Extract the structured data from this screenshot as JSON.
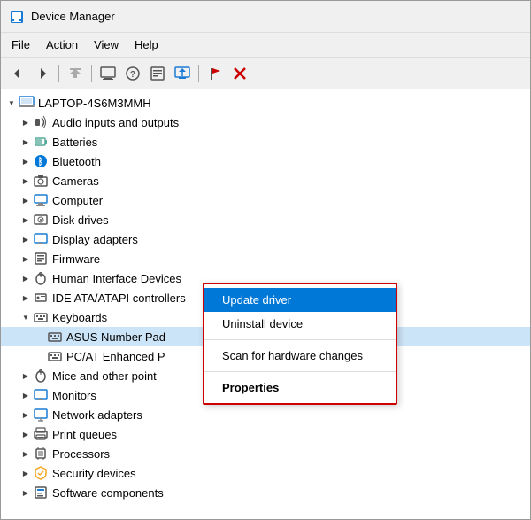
{
  "window": {
    "title": "Device Manager",
    "icon": "🖥"
  },
  "menu": {
    "items": [
      "File",
      "Action",
      "View",
      "Help"
    ]
  },
  "toolbar": {
    "buttons": [
      {
        "name": "back",
        "icon": "←",
        "disabled": false
      },
      {
        "name": "forward",
        "icon": "→",
        "disabled": false
      },
      {
        "name": "up",
        "icon": "↑",
        "disabled": true
      },
      {
        "name": "computer",
        "icon": "💻",
        "disabled": false
      },
      {
        "name": "help",
        "icon": "?",
        "disabled": false
      },
      {
        "name": "properties",
        "icon": "📋",
        "disabled": false
      },
      {
        "name": "monitor",
        "icon": "🖥",
        "disabled": false
      },
      {
        "name": "flag",
        "icon": "🚩",
        "disabled": false
      },
      {
        "name": "remove",
        "icon": "✖",
        "disabled": false,
        "red": true
      }
    ]
  },
  "tree": {
    "root": "LAPTOP-4S6M3MMH",
    "nodes": [
      {
        "label": "Audio inputs and outputs",
        "indent": 1,
        "expanded": false,
        "icon": "🔊"
      },
      {
        "label": "Batteries",
        "indent": 1,
        "expanded": false,
        "icon": "🔋"
      },
      {
        "label": "Bluetooth",
        "indent": 1,
        "expanded": false,
        "icon": "🔵"
      },
      {
        "label": "Cameras",
        "indent": 1,
        "expanded": false,
        "icon": "📷"
      },
      {
        "label": "Computer",
        "indent": 1,
        "expanded": false,
        "icon": "🖥"
      },
      {
        "label": "Disk drives",
        "indent": 1,
        "expanded": false,
        "icon": "💾"
      },
      {
        "label": "Display adapters",
        "indent": 1,
        "expanded": false,
        "icon": "🖵"
      },
      {
        "label": "Firmware",
        "indent": 1,
        "expanded": false,
        "icon": "📟"
      },
      {
        "label": "Human Interface Devices",
        "indent": 1,
        "expanded": false,
        "icon": "🖱"
      },
      {
        "label": "IDE ATA/ATAPI controllers",
        "indent": 1,
        "expanded": false,
        "icon": "⚙"
      },
      {
        "label": "Keyboards",
        "indent": 1,
        "expanded": true,
        "icon": "⌨"
      },
      {
        "label": "ASUS Number Pad",
        "indent": 2,
        "expanded": false,
        "icon": "⌨",
        "selected": true
      },
      {
        "label": "PC/AT Enhanced P",
        "indent": 2,
        "expanded": false,
        "icon": "⌨"
      },
      {
        "label": "Mice and other point",
        "indent": 1,
        "expanded": false,
        "icon": "🖱"
      },
      {
        "label": "Monitors",
        "indent": 1,
        "expanded": false,
        "icon": "🖥"
      },
      {
        "label": "Network adapters",
        "indent": 1,
        "expanded": false,
        "icon": "🌐"
      },
      {
        "label": "Print queues",
        "indent": 1,
        "expanded": false,
        "icon": "🖨"
      },
      {
        "label": "Processors",
        "indent": 1,
        "expanded": false,
        "icon": "💻"
      },
      {
        "label": "Security devices",
        "indent": 1,
        "expanded": false,
        "icon": "🔒"
      },
      {
        "label": "Software components",
        "indent": 1,
        "expanded": false,
        "icon": "📦"
      }
    ]
  },
  "context_menu": {
    "items": [
      {
        "label": "Update driver",
        "type": "active"
      },
      {
        "label": "Uninstall device",
        "type": "normal"
      },
      {
        "label": "sep"
      },
      {
        "label": "Scan for hardware changes",
        "type": "normal"
      },
      {
        "label": "sep"
      },
      {
        "label": "Properties",
        "type": "bold"
      }
    ]
  }
}
